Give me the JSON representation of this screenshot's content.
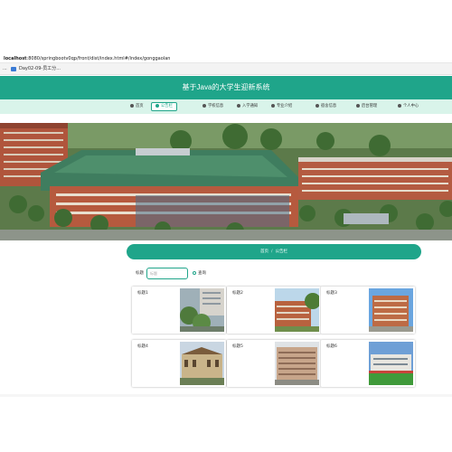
{
  "browser": {
    "url_host": "localhost",
    "url_rest": ":8080/springbootv0qp/front/dist/index.html#/index/gonggaolan",
    "left_dots": "...",
    "tab_title": "Day02-09-员工分..."
  },
  "header": {
    "title": "基于Java的大学生迎新系统"
  },
  "nav": {
    "items": [
      {
        "label": "首页",
        "icon": "home-icon"
      },
      {
        "label": "公告栏",
        "icon": "notice-icon",
        "active": true
      },
      {
        "label": "学校信息",
        "icon": "school-icon"
      },
      {
        "label": "入学通知",
        "icon": "notification-icon"
      },
      {
        "label": "专业介绍",
        "icon": "major-icon"
      },
      {
        "label": "宿舍信息",
        "icon": "dorm-icon"
      },
      {
        "label": "后台管理",
        "icon": "admin-icon"
      },
      {
        "label": "个人中心",
        "icon": "user-icon"
      }
    ]
  },
  "breadcrumb": {
    "home": "首页",
    "separator": "/",
    "current": "公告栏"
  },
  "search": {
    "label": "标题",
    "placeholder": "标题",
    "button": "查询"
  },
  "cards": [
    {
      "title": "标题1"
    },
    {
      "title": "标题2"
    },
    {
      "title": "标题3"
    },
    {
      "title": "标题4"
    },
    {
      "title": "标题5"
    },
    {
      "title": "标题6"
    }
  ],
  "colors": {
    "accent": "#1fa58a",
    "nav_bg": "#d9f4ea"
  }
}
